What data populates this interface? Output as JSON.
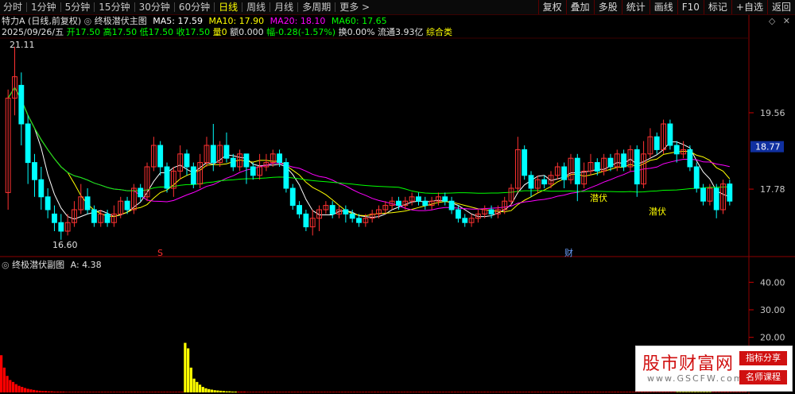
{
  "toolbar": {
    "timeframes": [
      "分时",
      "1分钟",
      "5分钟",
      "15分钟",
      "30分钟",
      "60分钟",
      "日线",
      "周线",
      "月线",
      "多周期",
      "更多 >"
    ],
    "active": "日线",
    "right_buttons": [
      "复权",
      "叠加",
      "多股",
      "统计",
      "画线",
      "F10",
      "标记",
      "+自选",
      "返回"
    ]
  },
  "main_header": {
    "stock": "特力A",
    "mode": "(日线,前复权)",
    "indicator": "终极潜伏主图",
    "ma5": "MA5: 17.59",
    "ma10": "MA10: 17.90",
    "ma20": "MA20: 18.10",
    "ma60": "MA60: 17.65"
  },
  "quote": {
    "date": "2025/09/26/五",
    "open": "开17.50",
    "high": "高17.50",
    "low": "低17.50",
    "close": "收17.50",
    "volume": "量0",
    "amount": "额0.000",
    "change": "幅-0.28(-1.57%)",
    "turnover": "换0.00%",
    "float": "流通3.93亿",
    "sector": "综合类"
  },
  "price_axis": [
    "19.56",
    "17.78"
  ],
  "current_price": "18.77",
  "annotations": {
    "high": "21.11",
    "low": "16.60",
    "s_marker": "S",
    "cai_marker": "财",
    "latent_1": "潜伏",
    "latent_2": "潜伏"
  },
  "sub_header": {
    "indicator": "终极潜伏副图",
    "value": "A: 4.38"
  },
  "sub_axis": [
    "40.00",
    "30.00",
    "20.00"
  ],
  "watermark": {
    "main": "股市财富网",
    "url": "www.GSCFW.com",
    "badge1": "指标分享",
    "badge2": "名师课程"
  },
  "colors": {
    "up": "#ff3232",
    "down": "#00ffff",
    "ma5": "#ffffff",
    "ma10": "#ffff00",
    "ma20": "#ff00ff",
    "ma60": "#00ff00",
    "volume_red": "#ff0000",
    "volume_yellow": "#ffff00"
  },
  "chart_data": {
    "type": "candlestick",
    "price_range": [
      16.3,
      21.3
    ],
    "candles": [
      [
        17.7,
        19.9,
        20.1,
        17.3
      ],
      [
        19.9,
        20.4,
        21.1,
        19.5
      ],
      [
        20.2,
        19.3,
        20.5,
        18.8
      ],
      [
        19.3,
        18.4,
        19.5,
        17.9
      ],
      [
        18.4,
        18.0,
        18.6,
        17.6
      ],
      [
        18.0,
        17.6,
        18.3,
        17.3
      ],
      [
        17.6,
        17.3,
        17.8,
        17.1
      ],
      [
        17.2,
        17.0,
        17.4,
        16.8
      ],
      [
        17.0,
        16.8,
        17.2,
        16.6
      ],
      [
        16.8,
        17.0,
        17.2,
        16.7
      ],
      [
        17.0,
        17.3,
        17.5,
        16.9
      ],
      [
        17.3,
        17.6,
        17.9,
        17.2
      ],
      [
        17.6,
        17.3,
        17.8,
        17.2
      ],
      [
        17.3,
        17.0,
        17.4,
        16.9
      ],
      [
        17.0,
        17.2,
        17.3,
        16.9
      ],
      [
        17.2,
        17.0,
        17.3,
        16.9
      ],
      [
        17.0,
        17.2,
        17.4,
        16.9
      ],
      [
        17.2,
        17.5,
        17.6,
        17.1
      ],
      [
        17.5,
        17.3,
        17.6,
        17.2
      ],
      [
        17.3,
        17.8,
        17.9,
        17.2
      ],
      [
        17.8,
        17.6,
        17.9,
        17.5
      ],
      [
        17.6,
        18.3,
        18.4,
        17.5
      ],
      [
        18.3,
        18.8,
        19.0,
        18.2
      ],
      [
        18.8,
        18.3,
        18.9,
        18.1
      ],
      [
        18.3,
        17.8,
        18.4,
        17.7
      ],
      [
        17.8,
        18.2,
        18.3,
        17.6
      ],
      [
        18.2,
        18.6,
        18.8,
        18.0
      ],
      [
        18.6,
        18.3,
        18.7,
        18.1
      ],
      [
        18.3,
        17.9,
        18.4,
        17.8
      ],
      [
        17.9,
        18.4,
        18.6,
        17.8
      ],
      [
        18.4,
        18.8,
        19.0,
        18.3
      ],
      [
        18.8,
        18.4,
        19.3,
        18.2
      ],
      [
        18.4,
        18.8,
        18.9,
        18.3
      ],
      [
        18.8,
        18.5,
        19.1,
        18.4
      ],
      [
        18.5,
        18.3,
        18.6,
        18.2
      ],
      [
        18.3,
        18.6,
        18.7,
        18.2
      ],
      [
        18.6,
        18.3,
        18.6,
        17.9
      ],
      [
        18.3,
        18.1,
        18.4,
        18.0
      ],
      [
        18.1,
        18.3,
        18.6,
        18.0
      ],
      [
        18.3,
        18.4,
        18.6,
        18.2
      ],
      [
        18.4,
        18.6,
        18.7,
        18.3
      ],
      [
        18.6,
        18.4,
        18.7,
        18.3
      ],
      [
        18.4,
        17.8,
        18.5,
        17.7
      ],
      [
        17.8,
        17.4,
        17.9,
        17.3
      ],
      [
        17.4,
        17.2,
        17.5,
        17.1
      ],
      [
        17.2,
        16.9,
        17.3,
        16.8
      ],
      [
        16.9,
        17.1,
        17.3,
        16.7
      ],
      [
        17.1,
        17.3,
        17.4,
        16.8
      ],
      [
        17.3,
        17.4,
        17.5,
        17.2
      ],
      [
        17.4,
        17.2,
        17.5,
        17.1
      ],
      [
        17.2,
        17.3,
        17.4,
        17.1
      ],
      [
        17.3,
        17.2,
        17.4,
        17.0
      ],
      [
        17.2,
        17.1,
        17.3,
        17.0
      ],
      [
        17.1,
        17.0,
        17.2,
        16.9
      ],
      [
        17.0,
        17.1,
        17.2,
        16.9
      ],
      [
        17.1,
        17.2,
        17.3,
        17.0
      ],
      [
        17.2,
        17.3,
        17.4,
        17.1
      ],
      [
        17.3,
        17.4,
        17.5,
        17.2
      ],
      [
        17.4,
        17.5,
        17.6,
        17.3
      ],
      [
        17.5,
        17.4,
        17.6,
        17.3
      ],
      [
        17.4,
        17.5,
        17.6,
        17.3
      ],
      [
        17.5,
        17.6,
        17.7,
        17.4
      ],
      [
        17.6,
        17.5,
        17.7,
        17.4
      ],
      [
        17.5,
        17.4,
        17.6,
        17.3
      ],
      [
        17.4,
        17.5,
        17.6,
        17.3
      ],
      [
        17.5,
        17.6,
        17.7,
        17.4
      ],
      [
        17.6,
        17.5,
        17.7,
        17.4
      ],
      [
        17.5,
        17.3,
        17.6,
        17.2
      ],
      [
        17.3,
        17.1,
        17.4,
        17.0
      ],
      [
        17.1,
        17.0,
        17.2,
        16.9
      ],
      [
        17.0,
        17.1,
        17.2,
        16.9
      ],
      [
        17.1,
        17.2,
        17.3,
        17.0
      ],
      [
        17.2,
        17.3,
        17.4,
        17.1
      ],
      [
        17.3,
        17.2,
        17.4,
        17.1
      ],
      [
        17.2,
        17.3,
        17.4,
        17.1
      ],
      [
        17.3,
        17.5,
        17.6,
        17.2
      ],
      [
        17.5,
        17.8,
        17.9,
        17.4
      ],
      [
        17.8,
        18.7,
        19.0,
        17.7
      ],
      [
        18.7,
        18.1,
        18.8,
        18.0
      ],
      [
        18.1,
        17.8,
        18.2,
        17.6
      ],
      [
        17.8,
        18.0,
        18.1,
        17.7
      ],
      [
        18.0,
        17.9,
        18.1,
        17.8
      ],
      [
        17.9,
        18.1,
        18.2,
        17.8
      ],
      [
        18.1,
        18.3,
        18.4,
        18.0
      ],
      [
        18.3,
        18.0,
        18.4,
        17.8
      ],
      [
        18.0,
        18.5,
        18.6,
        17.9
      ],
      [
        18.5,
        17.9,
        18.6,
        17.5
      ],
      [
        17.9,
        18.2,
        18.4,
        17.8
      ],
      [
        18.2,
        18.4,
        18.6,
        18.1
      ],
      [
        18.4,
        18.2,
        18.5,
        18.1
      ],
      [
        18.2,
        18.5,
        18.6,
        18.1
      ],
      [
        18.5,
        18.3,
        18.6,
        18.2
      ],
      [
        18.3,
        18.6,
        18.7,
        18.2
      ],
      [
        18.6,
        18.3,
        18.7,
        18.2
      ],
      [
        18.3,
        18.7,
        18.8,
        18.2
      ],
      [
        18.7,
        17.9,
        18.8,
        17.6
      ],
      [
        17.9,
        18.6,
        18.9,
        17.8
      ],
      [
        18.6,
        19.0,
        19.2,
        18.5
      ],
      [
        19.0,
        18.7,
        19.1,
        18.6
      ],
      [
        18.7,
        19.3,
        19.4,
        18.6
      ],
      [
        19.3,
        18.8,
        19.4,
        18.7
      ],
      [
        18.8,
        18.6,
        18.9,
        18.4
      ],
      [
        18.6,
        18.7,
        18.9,
        18.5
      ],
      [
        18.7,
        18.3,
        18.8,
        18.2
      ],
      [
        18.3,
        17.8,
        18.4,
        17.7
      ],
      [
        17.8,
        17.5,
        17.9,
        17.4
      ],
      [
        17.5,
        17.8,
        17.9,
        17.4
      ],
      [
        17.8,
        17.3,
        17.9,
        17.1
      ],
      [
        17.3,
        17.9,
        18.0,
        17.2
      ],
      [
        17.9,
        17.5,
        18.0,
        17.4
      ]
    ],
    "sub_series": {
      "name": "A",
      "values": [
        13.5,
        9,
        6,
        4.5,
        3.8,
        3,
        2.4,
        2,
        1.6,
        1.3,
        1.1,
        0.9,
        0.7,
        0.6,
        0.5,
        0.5,
        0.4,
        0.4,
        0.3,
        0.3,
        0.3,
        0.3,
        0.2,
        0.2,
        0.2,
        0.2,
        0.2,
        0.2,
        0.2,
        0.2,
        0.2,
        0.2,
        0.2,
        0.2,
        0.2,
        0.2,
        0.2,
        0.2,
        0.2,
        0.2,
        0.2,
        0.2,
        0.2,
        0.2,
        0.2,
        0.2,
        0.2,
        0.2,
        0.2,
        0.2,
        0.2,
        0.2,
        0.2,
        0.2,
        0.2,
        0.2,
        0.2,
        0.2,
        0.2,
        0.2,
        0.2,
        0.2,
        18,
        16,
        9,
        5,
        3.8,
        2.8,
        2,
        1.5,
        1.2,
        1,
        0.8,
        0.7,
        0.6,
        0.5,
        0.4,
        0.4,
        0.3,
        0.3,
        0.3,
        0.3,
        0.3,
        0.2,
        0.2,
        0.2,
        0.2,
        0.2,
        0.2,
        0.2,
        0.2,
        0.2,
        0.2,
        0.2,
        0.2,
        0.2,
        0.2,
        0.2,
        0.2,
        0.2,
        0.2,
        0.2,
        0.2,
        0.2,
        0.2,
        0.2,
        0.2,
        0.2,
        0.2,
        0.2,
        0.2,
        0.2,
        0.2,
        0.2,
        0.2,
        0.2,
        0.2,
        0.2,
        0.2,
        0.2,
        0.2,
        0.2,
        0.2,
        0.2,
        0.2,
        0.2,
        0.2,
        0.2,
        0.2,
        0.2,
        0.2,
        0.2,
        0.2,
        0.2,
        0.2,
        0.2,
        0.2,
        0.2,
        0.2,
        0.2,
        0.2,
        0.2,
        0.2,
        0.2,
        0.2,
        0.2,
        0.2,
        0.2,
        0.2,
        0.2,
        0.2,
        0.2,
        0.2,
        0.2,
        0.2,
        0.2,
        0.2,
        0.2,
        0.2,
        0.2,
        0.2,
        0.2,
        0.2,
        0.2,
        0.2,
        0.2,
        0.2,
        0.2,
        0.2,
        0.2,
        0.2,
        0.2,
        0.2,
        0.2,
        0.2,
        0.2,
        0.2,
        0.2,
        0.2,
        0.2,
        0.2,
        0.2,
        0.2,
        0.2,
        0.2,
        0.2,
        0.2,
        0.2,
        0.2,
        0.2,
        0.2,
        0.2,
        0.2,
        0.2,
        0.2,
        0.2,
        0.2,
        0.2,
        0.2,
        0.2,
        0.2,
        0.2,
        0.2,
        0.2,
        0.2,
        0.2,
        0.2,
        0.2,
        0.2,
        0.2,
        0.2,
        0.2,
        0.2,
        0.2,
        0.2,
        0.2,
        0.2,
        0.2,
        0.2,
        0.2,
        0.2,
        0.2,
        0.2,
        0.2,
        0.2,
        0.2,
        0.2,
        0.2,
        0.2,
        0.2,
        0.2,
        0.2,
        0.2,
        0.2,
        0.2,
        0.2,
        0.2,
        0.2,
        0.2,
        0.2,
        0.2,
        0.2,
        0.2,
        0.2,
        0.2,
        0.2,
        0.2,
        0.2,
        0.2,
        0.2,
        0.2,
        0.2
      ],
      "range": [
        0,
        45
      ]
    }
  }
}
